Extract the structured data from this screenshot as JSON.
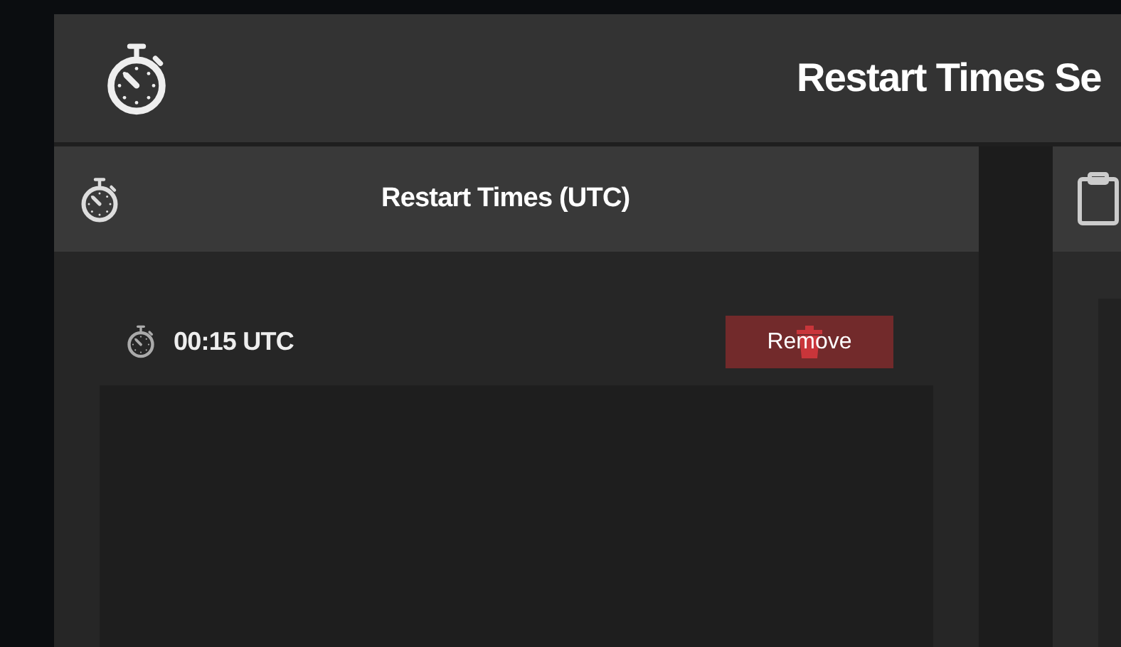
{
  "header": {
    "title": "Restart Times Se"
  },
  "restart_panel": {
    "title": "Restart Times (UTC)",
    "times": [
      {
        "time": "00:15 UTC",
        "remove_label": "Remove"
      }
    ]
  }
}
